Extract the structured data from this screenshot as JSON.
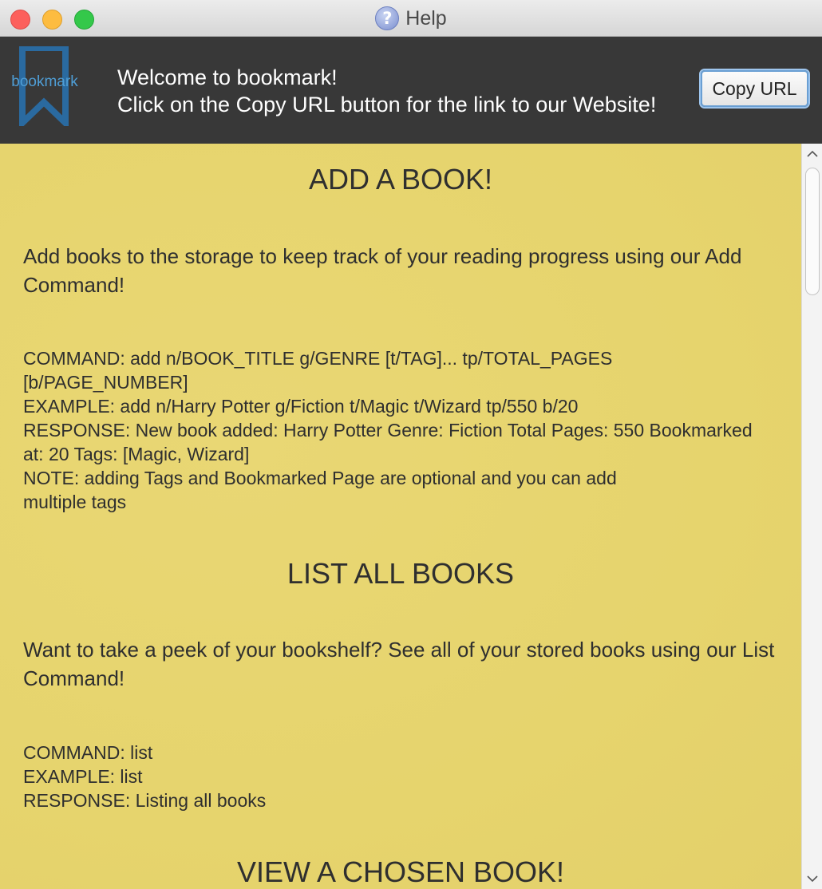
{
  "window": {
    "title": "Help",
    "icon": "help-question-icon"
  },
  "header": {
    "logo_text": "bookmark",
    "logo_icon": "bookmark-icon",
    "welcome_line1": "Welcome to bookmark!",
    "welcome_line2": "Click on the Copy URL button for the link to our Website!",
    "copy_button": "Copy URL"
  },
  "sections": [
    {
      "title": "ADD A BOOK!",
      "description": "Add books to the storage to keep track of your reading progress using our Add Command!",
      "lines": [
        "COMMAND: add n/BOOK_TITLE g/GENRE [t/TAG]... tp/TOTAL_PAGES",
        "[b/PAGE_NUMBER]",
        "EXAMPLE: add n/Harry Potter g/Fiction t/Magic t/Wizard tp/550 b/20",
        "RESPONSE: New book added: Harry Potter Genre: Fiction Total Pages: 550 Bookmarked",
        "at: 20 Tags: [Magic, Wizard]",
        "NOTE: adding Tags and Bookmarked Page are optional and you can add",
        "multiple tags"
      ]
    },
    {
      "title": "LIST ALL BOOKS",
      "description": "Want to take a peek of your bookshelf? See all of your stored books using our List Command!",
      "lines": [
        "COMMAND: list",
        "EXAMPLE: list",
        "RESPONSE: Listing all books"
      ]
    },
    {
      "title": "VIEW A CHOSEN BOOK!"
    }
  ],
  "colors": {
    "content_background": "#e6d46e",
    "header_background": "#383838",
    "logo_accent": "#4f9ed6"
  }
}
